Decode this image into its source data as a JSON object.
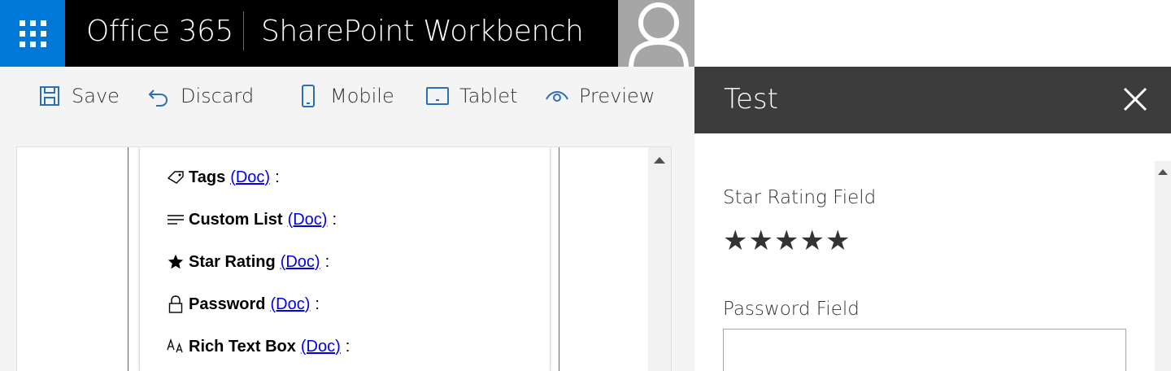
{
  "suitebar": {
    "brand": "Office 365",
    "app_name": "SharePoint Workbench",
    "waffle_icon": "app-launcher-icon",
    "avatar_icon": "person-icon"
  },
  "commands": {
    "save": "Save",
    "discard": "Discard",
    "mobile": "Mobile",
    "tablet": "Tablet",
    "preview": "Preview"
  },
  "webpart": {
    "fields": [
      {
        "icon": "tag-icon",
        "name": "Tags",
        "doc": "(Doc)",
        "colon": ":"
      },
      {
        "icon": "list-icon",
        "name": "Custom List",
        "doc": "(Doc)",
        "colon": ":"
      },
      {
        "icon": "star-icon",
        "name": "Star Rating",
        "doc": "(Doc)",
        "colon": ":"
      },
      {
        "icon": "lock-icon",
        "name": "Password",
        "doc": "(Doc)",
        "colon": ":"
      },
      {
        "icon": "font-size-icon",
        "name": "Rich Text Box",
        "doc": "(Doc)",
        "colon": ":"
      }
    ]
  },
  "panel": {
    "title": "Test",
    "star_rating_label": "Star Rating Field",
    "star_rating_value": 5,
    "star_rating_max": 5,
    "password_label": "Password Field",
    "password_value": ""
  },
  "colors": {
    "accent": "#0078d7",
    "suitebar": "#000000",
    "panel_header": "#3c3c3c",
    "link": "#0000ee"
  }
}
